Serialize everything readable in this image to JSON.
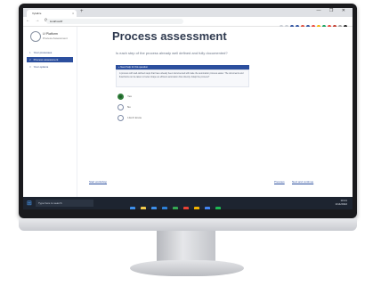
{
  "browser": {
    "tab_label": "Vytalize",
    "tab_close": "×",
    "new_tab": "+",
    "window_controls": "— ❐ ✕",
    "nav_buttons": "← → ⟳",
    "url": "localhost/lf",
    "extension_colors": [
      "#c7cbd2",
      "#c7cbd2",
      "#2c4f9e",
      "#2c4f9e",
      "#dd4b39",
      "#2c4f9e",
      "#e94235",
      "#f4b400",
      "#0f9d58",
      "#e94235",
      "#c0392b",
      "#a0a0a0",
      "#222222"
    ]
  },
  "sidebar": {
    "brand_name": "Lf Platform",
    "brand_sub": "Process Assessment",
    "items": [
      {
        "num": "1",
        "label": "Your processes",
        "active": false
      },
      {
        "num": "2",
        "label": "Process assessment",
        "active": true
      },
      {
        "num": "3",
        "label": "Your options",
        "active": false
      }
    ]
  },
  "main": {
    "title": "Process assessment",
    "question": "Is each step of the process already well defined and fully documented?",
    "help_header": "+ Need help for this question",
    "help_body": "A process with well-defined steps that have already been documented will make the automation process easier. The documents and flowcharts can be taken to better shape an efficient automation flow directly. Adapt the process?",
    "options": [
      {
        "label": "Yes",
        "checked": true
      },
      {
        "label": "No",
        "checked": false
      },
      {
        "label": "I don't know",
        "checked": false
      }
    ],
    "footer": {
      "start_over": "Start workshop",
      "previous": "Previous",
      "next": "Next and continue"
    }
  },
  "taskbar": {
    "start": "⊞",
    "search_placeholder": "Type here to search",
    "app_colors": [
      "#3d8eea",
      "#f2c94c",
      "#3d8eea",
      "#2d7fd6",
      "#35a853",
      "#e94235",
      "#f4b400",
      "#4285f4",
      "#1db954"
    ],
    "tray_time": "10:21",
    "tray_date": "1/14/2022"
  }
}
